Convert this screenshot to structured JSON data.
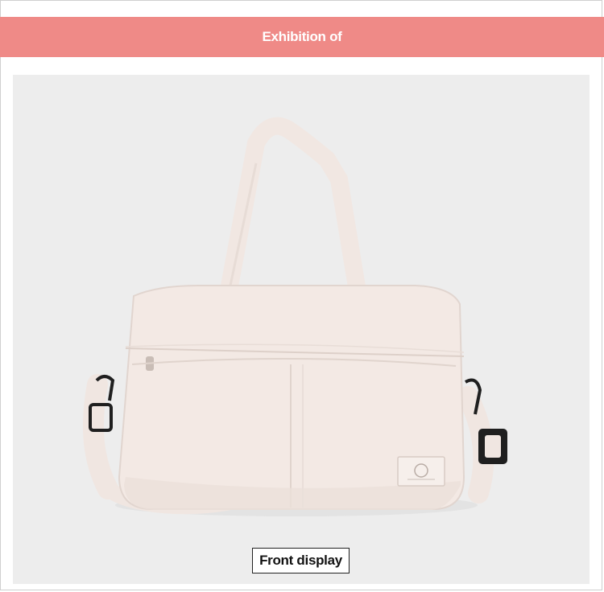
{
  "header": {
    "title": "Exhibition of",
    "bar_color": "#ef8a87"
  },
  "product_image": {
    "subject": "bag-illustration",
    "bag_color": "#f3e9e4",
    "background_color": "#ededed"
  },
  "caption": {
    "label": "Front display"
  }
}
